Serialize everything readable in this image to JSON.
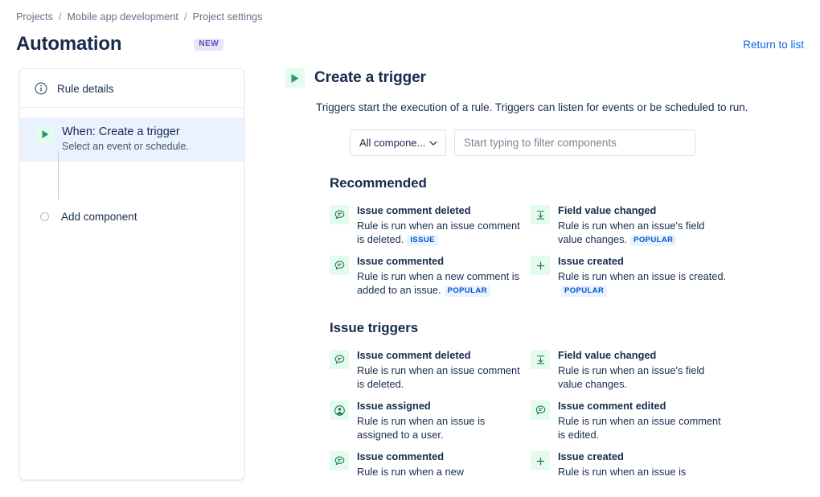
{
  "breadcrumb": {
    "items": [
      "Projects",
      "Mobile app development",
      "Project settings"
    ],
    "separator": "/"
  },
  "header": {
    "title": "Automation",
    "new_badge": "NEW",
    "return_link": "Return to list"
  },
  "colors": {
    "accent_link": "#0c66e4",
    "badge_new_text": "#5e4db2",
    "badge_new_bg": "#e9e6fb",
    "tag_text": "#0055cc",
    "tag_bg": "#e9f2ff",
    "icon_bg_green": "#e3fcef",
    "icon_green": "#216e4e",
    "selected_row_bg": "#e9f2fe",
    "text_primary": "#172b4d",
    "text_subtle": "#626f86"
  },
  "sidebar": {
    "rule_details": {
      "label": "Rule details",
      "icon": "info-icon"
    },
    "nodes": [
      {
        "title": "When: Create a trigger",
        "subtitle": "Select an event or schedule.",
        "icon": "play-icon",
        "selected": true
      },
      {
        "title": "Add component",
        "icon": "empty-circle-icon",
        "selected": false
      }
    ]
  },
  "main": {
    "icon": "play-icon",
    "title": "Create a trigger",
    "description": "Triggers start the execution of a rule. Triggers can listen for events or be scheduled to run.",
    "filter": {
      "select_value": "All compone...",
      "select_icon": "chevron-down-icon",
      "search_placeholder": "Start typing to filter components",
      "search_value": ""
    },
    "sections": [
      {
        "title": "Recommended",
        "triggers": [
          {
            "name": "Issue comment deleted",
            "description": "Rule is run when an issue comment is deleted.",
            "tag": "ISSUE",
            "icon": "comment-icon"
          },
          {
            "name": "Field value changed",
            "description": "Rule is run when an issue's field value changes.",
            "tag": "POPULAR",
            "icon": "field-value-icon"
          },
          {
            "name": "Issue commented",
            "description": "Rule is run when a new comment is added to an issue.",
            "tag": "POPULAR",
            "icon": "comment-icon"
          },
          {
            "name": "Issue created",
            "description": "Rule is run when an issue is created.",
            "tag": "POPULAR",
            "icon": "plus-icon"
          }
        ]
      },
      {
        "title": "Issue triggers",
        "triggers": [
          {
            "name": "Issue comment deleted",
            "description": "Rule is run when an issue comment is deleted.",
            "tag": "",
            "icon": "comment-icon"
          },
          {
            "name": "Field value changed",
            "description": "Rule is run when an issue's field value changes.",
            "tag": "",
            "icon": "field-value-icon"
          },
          {
            "name": "Issue assigned",
            "description": "Rule is run when an issue is assigned to a user.",
            "tag": "",
            "icon": "user-avatar-icon"
          },
          {
            "name": "Issue comment edited",
            "description": "Rule is run when an issue comment is edited.",
            "tag": "",
            "icon": "comment-icon"
          },
          {
            "name": "Issue commented",
            "description": "Rule is run when a new",
            "tag": "",
            "icon": "comment-icon"
          },
          {
            "name": "Issue created",
            "description": "Rule is run when an issue is",
            "tag": "",
            "icon": "plus-icon"
          }
        ]
      }
    ]
  }
}
